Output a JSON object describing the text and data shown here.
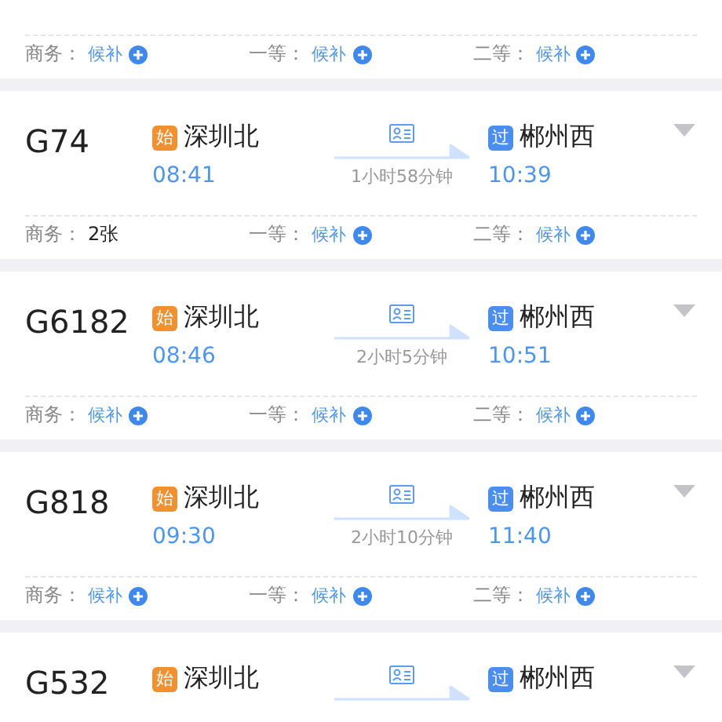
{
  "trains": [
    {
      "seats": [
        {
          "label": "商务：",
          "kind": "waitlist",
          "value": "候补"
        },
        {
          "label": "一等：",
          "kind": "waitlist",
          "value": "候补"
        },
        {
          "label": "二等：",
          "kind": "waitlist",
          "value": "候补"
        }
      ]
    },
    {
      "train": "G74",
      "from": {
        "badge": "始",
        "kind": "origin",
        "station": "深圳北",
        "time": "08:41"
      },
      "duration": "1小时58分钟",
      "to": {
        "badge": "过",
        "kind": "pass",
        "station": "郴州西",
        "time": "10:39"
      },
      "seats": [
        {
          "label": "商务：",
          "kind": "count",
          "value": "2张"
        },
        {
          "label": "一等：",
          "kind": "waitlist",
          "value": "候补"
        },
        {
          "label": "二等：",
          "kind": "waitlist",
          "value": "候补"
        }
      ]
    },
    {
      "train": "G6182",
      "from": {
        "badge": "始",
        "kind": "origin",
        "station": "深圳北",
        "time": "08:46"
      },
      "duration": "2小时5分钟",
      "to": {
        "badge": "过",
        "kind": "pass",
        "station": "郴州西",
        "time": "10:51"
      },
      "seats": [
        {
          "label": "商务：",
          "kind": "waitlist",
          "value": "候补"
        },
        {
          "label": "一等：",
          "kind": "waitlist",
          "value": "候补"
        },
        {
          "label": "二等：",
          "kind": "waitlist",
          "value": "候补"
        }
      ]
    },
    {
      "train": "G818",
      "from": {
        "badge": "始",
        "kind": "origin",
        "station": "深圳北",
        "time": "09:30"
      },
      "duration": "2小时10分钟",
      "to": {
        "badge": "过",
        "kind": "pass",
        "station": "郴州西",
        "time": "11:40"
      },
      "seats": [
        {
          "label": "商务：",
          "kind": "waitlist",
          "value": "候补"
        },
        {
          "label": "一等：",
          "kind": "waitlist",
          "value": "候补"
        },
        {
          "label": "二等：",
          "kind": "waitlist",
          "value": "候补"
        }
      ]
    },
    {
      "train": "G532",
      "from": {
        "badge": "始",
        "kind": "origin",
        "station": "深圳北"
      },
      "to": {
        "badge": "过",
        "kind": "pass",
        "station": "郴州西"
      }
    }
  ]
}
